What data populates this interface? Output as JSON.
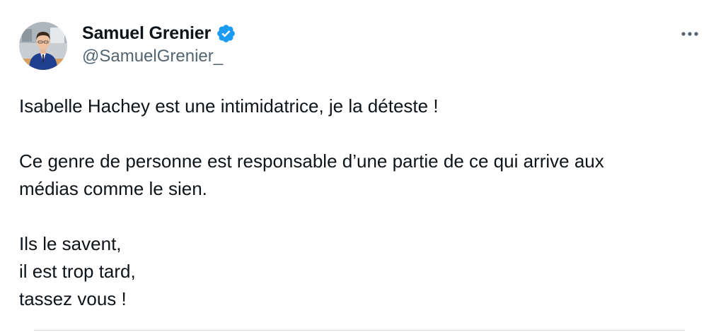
{
  "author": {
    "display_name": "Samuel Grenier",
    "handle": "@SamuelGrenier_",
    "verified": true,
    "avatar_icon": "profile-photo"
  },
  "menu": {
    "icon": "more-horizontal-icon"
  },
  "tweet": {
    "paragraphs": [
      [
        "Isabelle Hachey est une intimidatrice, je la déteste !"
      ],
      [
        "Ce genre de personne est responsable d’une partie de ce qui arrive aux",
        "médias comme le sien."
      ],
      [
        "Ils le savent,",
        "il est trop tard,",
        "tassez vous !"
      ]
    ]
  },
  "colors": {
    "text": "#0f1419",
    "secondary_text": "#536471",
    "verified_blue": "#1d9bf0",
    "divider": "#cfd9de"
  }
}
